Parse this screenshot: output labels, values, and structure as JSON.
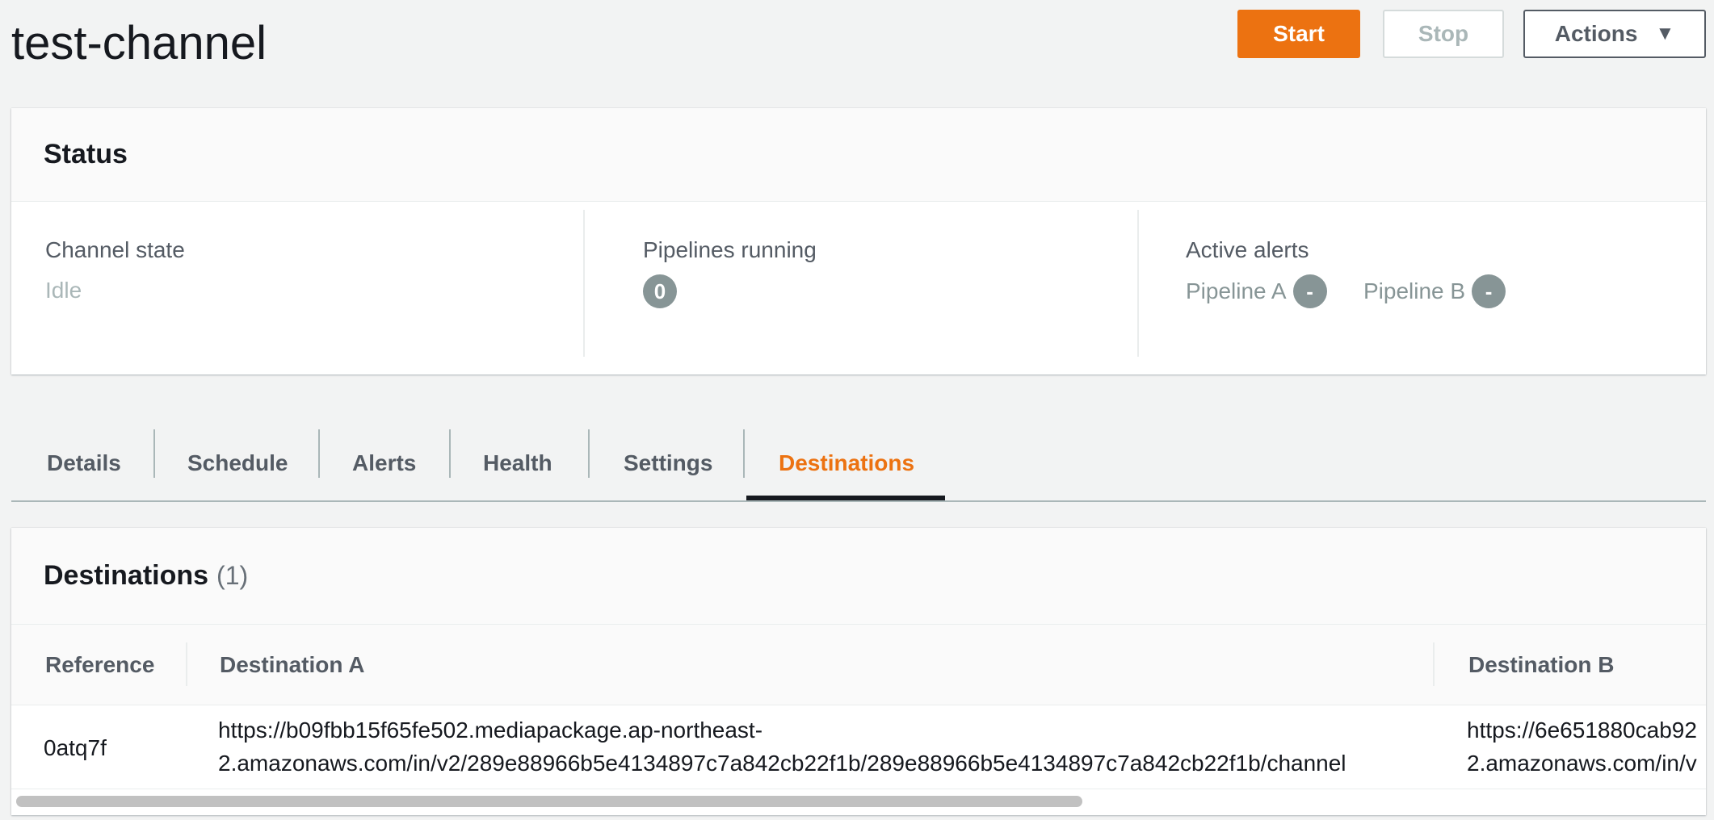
{
  "page": {
    "title": "test-channel"
  },
  "toolbar": {
    "start_label": "Start",
    "stop_label": "Stop",
    "actions_label": "Actions",
    "actions_caret": "▼"
  },
  "status": {
    "heading": "Status",
    "channel_state": {
      "label": "Channel state",
      "value": "Idle"
    },
    "pipelines_running": {
      "label": "Pipelines running",
      "value": "0"
    },
    "active_alerts": {
      "label": "Active alerts",
      "pipeline_a": {
        "label": "Pipeline A",
        "value": "-"
      },
      "pipeline_b": {
        "label": "Pipeline B",
        "value": "-"
      }
    }
  },
  "tabs": [
    {
      "label": "Details"
    },
    {
      "label": "Schedule"
    },
    {
      "label": "Alerts"
    },
    {
      "label": "Health"
    },
    {
      "label": "Settings"
    },
    {
      "label": "Destinations",
      "active": true
    }
  ],
  "destinations": {
    "heading": "Destinations",
    "count": "(1)",
    "columns": [
      "Reference",
      "Destination A",
      "Destination B"
    ],
    "rows": [
      {
        "reference": "0atq7f",
        "destination_a_line1": "https://b09fbb15f65fe502.mediapackage.ap-northeast-",
        "destination_a_line2": "2.amazonaws.com/in/v2/289e88966b5e4134897c7a842cb22f1b/289e88966b5e4134897c7a842cb22f1b/channel",
        "destination_b_line1": "https://6e651880cab92",
        "destination_b_line2": "2.amazonaws.com/in/v"
      }
    ]
  },
  "colors": {
    "accent": "#ec7211",
    "text": "#16191f",
    "muted": "#aab7b8",
    "badge": "#879596"
  }
}
